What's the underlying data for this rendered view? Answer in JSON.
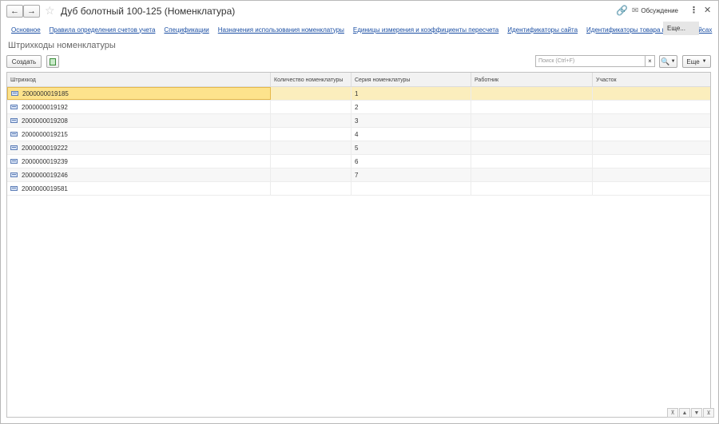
{
  "window": {
    "title": "Дуб болотный 100-125 (Номенклатура)",
    "discussion_label": "Обсуждение"
  },
  "tabs": [
    "Основное",
    "Правила определения счетов учета",
    "Спецификации",
    "Назначения использования номенклатуры",
    "Единицы измерения и коэффициенты пересчета",
    "Идентификаторы сайта",
    "Идентификаторы товара в маркетплейсах"
  ],
  "tabs_more_label": "Еще...",
  "section_title": "Штрихкоды номенклатуры",
  "toolbar": {
    "create_label": "Создать",
    "search_placeholder": "Поиск (Ctrl+F)",
    "more_label": "Еще"
  },
  "table": {
    "columns": [
      "Штрихкод",
      "Количество номенклатуры",
      "Серия номенклатуры",
      "Работник",
      "Участок"
    ],
    "rows": [
      {
        "barcode": "2000000019185",
        "qty": "",
        "series": "1",
        "worker": "",
        "area": ""
      },
      {
        "barcode": "2000000019192",
        "qty": "",
        "series": "2",
        "worker": "",
        "area": ""
      },
      {
        "barcode": "2000000019208",
        "qty": "",
        "series": "3",
        "worker": "",
        "area": ""
      },
      {
        "barcode": "2000000019215",
        "qty": "",
        "series": "4",
        "worker": "",
        "area": ""
      },
      {
        "barcode": "2000000019222",
        "qty": "",
        "series": "5",
        "worker": "",
        "area": ""
      },
      {
        "barcode": "2000000019239",
        "qty": "",
        "series": "6",
        "worker": "",
        "area": ""
      },
      {
        "barcode": "2000000019246",
        "qty": "",
        "series": "7",
        "worker": "",
        "area": ""
      },
      {
        "barcode": "2000000019581",
        "qty": "",
        "series": "",
        "worker": "",
        "area": ""
      }
    ],
    "selected_row": 0
  },
  "colors": {
    "link": "#1a4ea3",
    "selected_row": "#fbeebd",
    "focused_cell": "#fde38c"
  }
}
